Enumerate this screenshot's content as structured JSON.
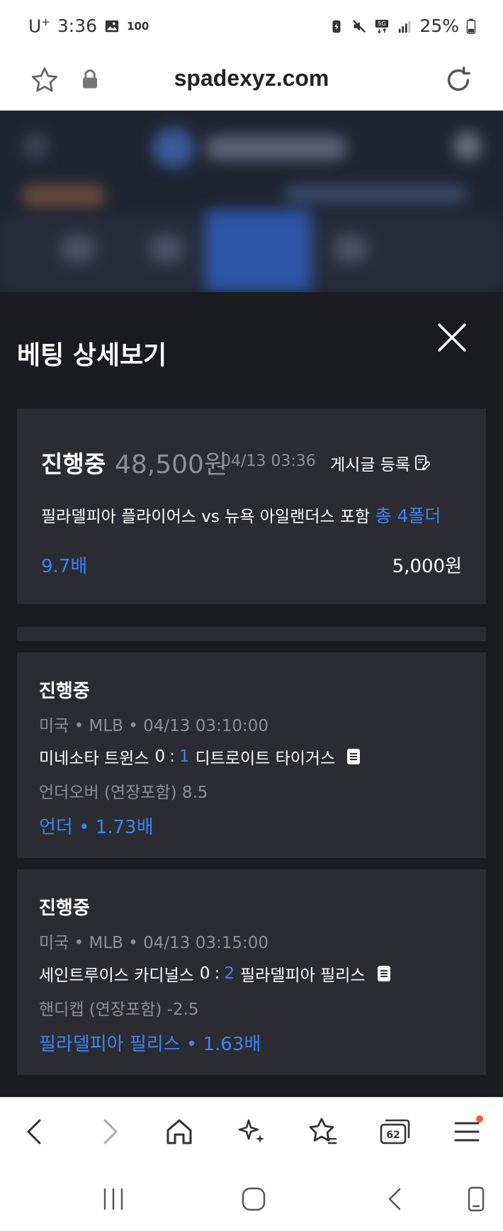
{
  "status_bar": {
    "carrier": "U",
    "carrier_sup": "+",
    "time": "3:36",
    "badge": "100",
    "battery": "25%"
  },
  "browser": {
    "url": "spadexyz.com",
    "tabs_count": "62"
  },
  "modal": {
    "title": "베팅 상세보기",
    "summary": {
      "status": "진행중",
      "amount": "48,500원",
      "time": "04/13 03:36",
      "post_label": "게시글 등록",
      "match_text": "필라델피아 플라이어스 vs 뉴욕 아일랜더스 포함",
      "folder_text": "총 4폴더",
      "odds": "9.7배",
      "stake": "5,000원"
    },
    "bets": [
      {
        "status": "진행중",
        "meta": "미국 • MLB • 04/13 03:10:00",
        "home": "미네소타 트윈스",
        "home_score": "0",
        "away_score": "1",
        "away": "디트로이트 타이거스",
        "market": "언더오버 (연장포함) 8.5",
        "pick": "언더 • 1.73배"
      },
      {
        "status": "진행중",
        "meta": "미국 • MLB • 04/13 03:15:00",
        "home": "세인트루이스 카디널스",
        "home_score": "0",
        "away_score": "2",
        "away": "필라델피아 필리스",
        "market": "핸디캡 (연장포함) -2.5",
        "pick": "필라델피아 필리스 • 1.63배"
      }
    ]
  },
  "colors": {
    "accent": "#3d83f5",
    "card_bg": "#2a2c31",
    "modal_bg": "#1a1b1f",
    "muted_text": "#8d8f95"
  }
}
